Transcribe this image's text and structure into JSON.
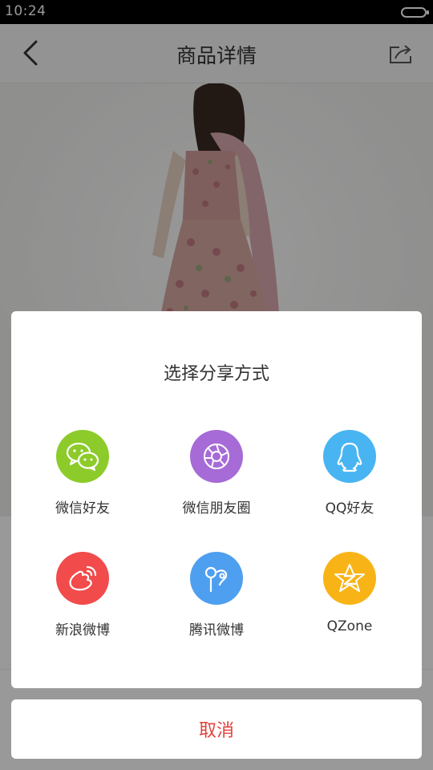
{
  "status_bar": {
    "time": "10:24"
  },
  "app_bar": {
    "title": "商品详情",
    "back_icon": "chevron-left-icon",
    "share_icon": "share-icon"
  },
  "share_dialog": {
    "title": "选择分享方式",
    "options": [
      {
        "label": "微信好友",
        "icon": "wechat-icon",
        "color": "#8CCB2A"
      },
      {
        "label": "微信朋友圈",
        "icon": "moments-icon",
        "color": "#A66BD6"
      },
      {
        "label": "QQ好友",
        "icon": "qq-icon",
        "color": "#48B4F2"
      },
      {
        "label": "新浪微博",
        "icon": "weibo-icon",
        "color": "#F24B4B"
      },
      {
        "label": "腾讯微博",
        "icon": "tencent-weibo-icon",
        "color": "#4E9FEF"
      },
      {
        "label": "QZone",
        "icon": "qzone-icon",
        "color": "#F8B417"
      }
    ]
  },
  "cancel": {
    "label": "取消",
    "color": "#E4413C"
  }
}
